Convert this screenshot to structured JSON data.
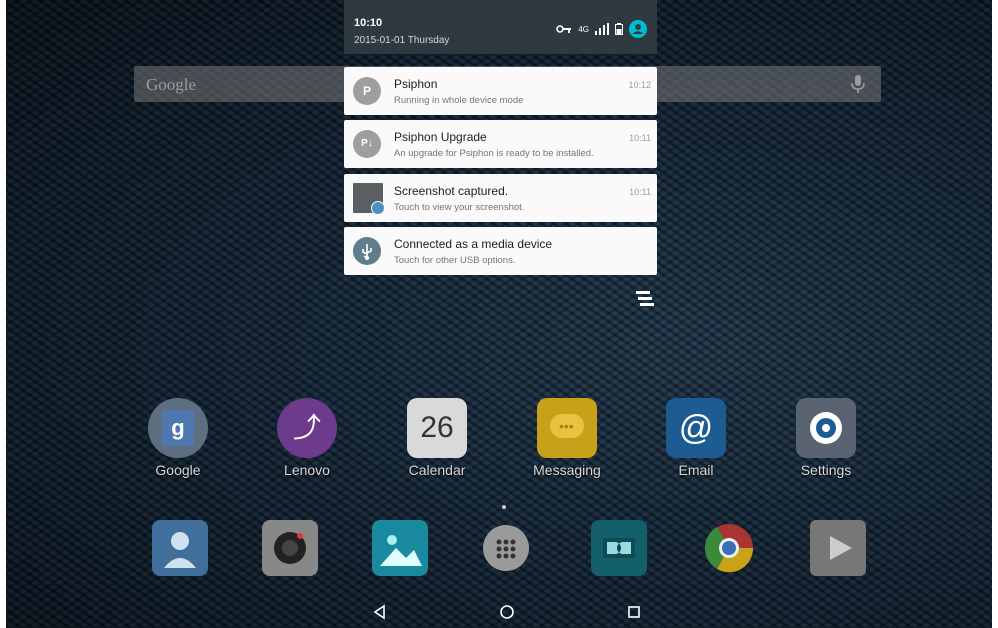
{
  "status_bar": {
    "time": "10:10",
    "date": "2015-01-01 Thursday",
    "network": "4G"
  },
  "search": {
    "placeholder": "Google"
  },
  "notifications": [
    {
      "icon": "P",
      "title": "Psiphon",
      "text": "Running in whole device mode",
      "time": "10:12"
    },
    {
      "icon": "P↓",
      "title": "Psiphon Upgrade",
      "text": "An upgrade for Psiphon is ready to be installed.",
      "time": "10:11"
    },
    {
      "icon": "screenshot-thumbnail",
      "title": "Screenshot captured.",
      "text": "Touch to view your screenshot.",
      "time": "10:11"
    },
    {
      "icon": "usb-icon",
      "title": "Connected as a media device",
      "text": "Touch for other USB options.",
      "time": ""
    }
  ],
  "apps": [
    {
      "label": "Google"
    },
    {
      "label": "Lenovo"
    },
    {
      "label": "Calendar",
      "day": "26"
    },
    {
      "label": "Messaging"
    },
    {
      "label": "Email"
    },
    {
      "label": "Settings"
    }
  ],
  "dock": [
    "contacts-icon",
    "camera-icon",
    "gallery-icon",
    "app-drawer-icon",
    "dolby-icon",
    "chrome-icon",
    "play-store-icon"
  ],
  "colors": {
    "shade": "#2f3a40",
    "card": "#fafafa",
    "accent": "#00bcd4"
  }
}
